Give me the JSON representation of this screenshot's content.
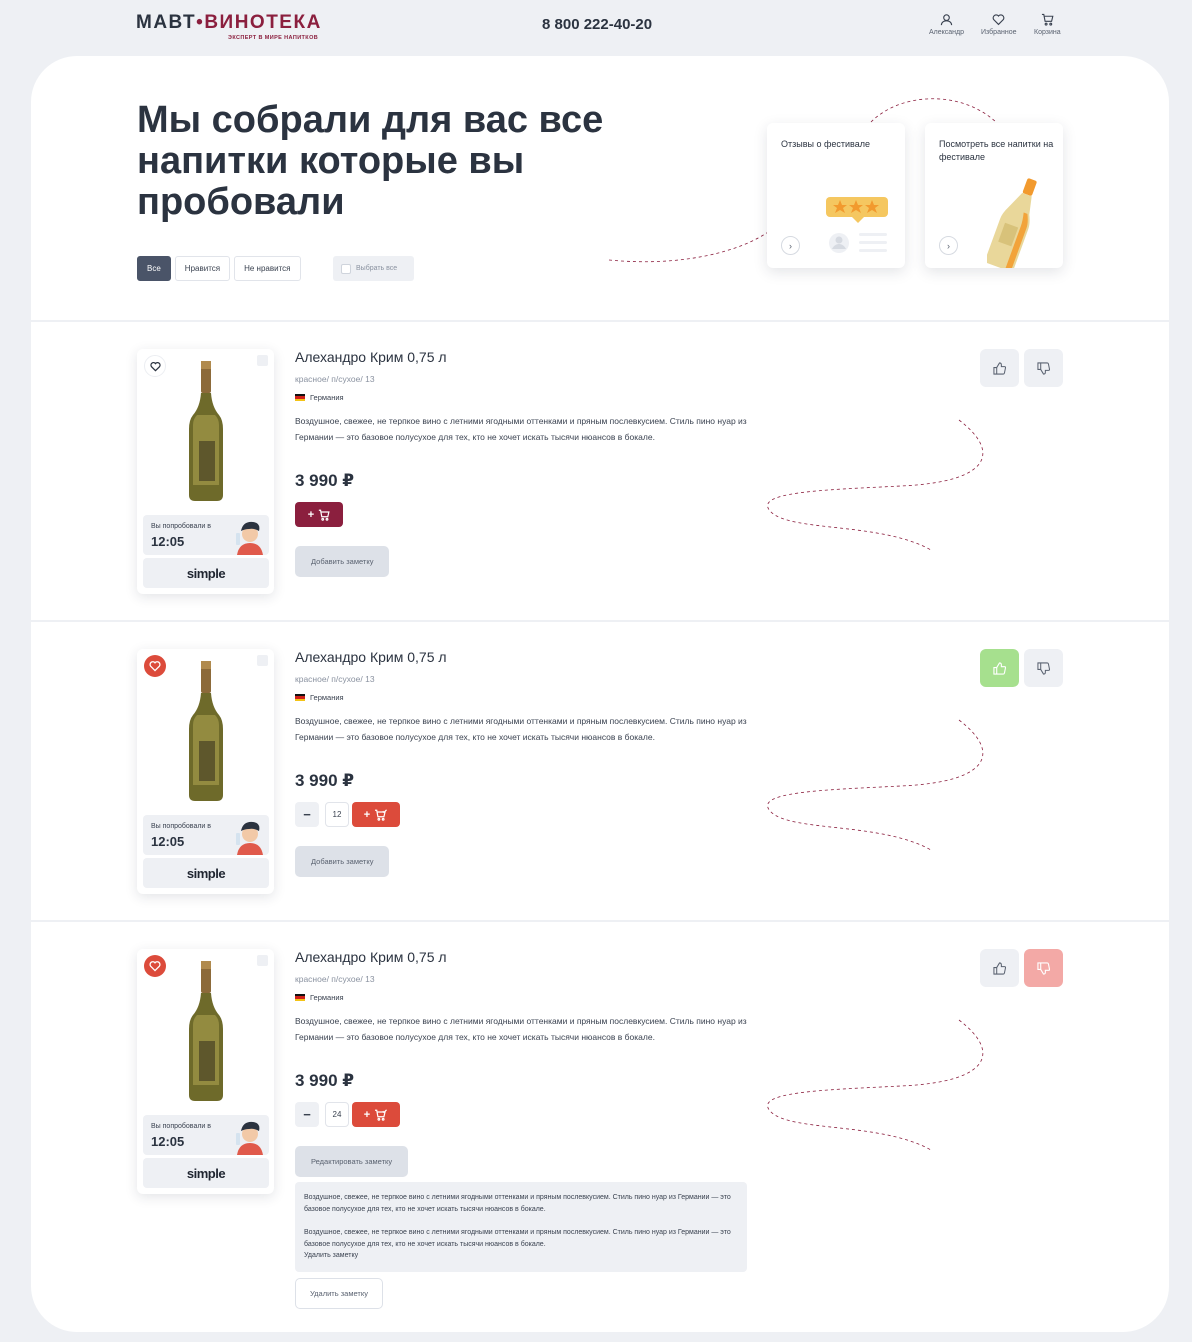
{
  "header": {
    "logo_left": "МАВТ",
    "logo_dot": "•",
    "logo_right": "ВИНОТЕКА",
    "logo_tagline": "ЭКСПЕРТ В МИРЕ НАПИТКОВ",
    "phone": "8 800 222-40-20",
    "nav": [
      {
        "label": "Александр",
        "icon": "user-icon"
      },
      {
        "label": "Избранное",
        "icon": "heart-icon"
      },
      {
        "label": "Корзина",
        "icon": "cart-icon"
      }
    ]
  },
  "hero": {
    "title": "Мы собрали для вас все напитки которые вы пробовали",
    "filters": [
      "Все",
      "Нравится",
      "Не нравится"
    ],
    "active_filter": "Все",
    "select_all": "Выбрать все",
    "promos": [
      {
        "title": "Отзывы о фестивале",
        "icon": "stars-review-illustration"
      },
      {
        "title": "Посмотреть все напитки на фестивале",
        "icon": "bottle-illustration"
      }
    ]
  },
  "products": [
    {
      "name": "Алехандро Крим 0,75 л",
      "meta": "красное/ п/сухое/ 13",
      "country": "Германия",
      "description": "Воздушное, свежее, не терпкое вино с летними ягодными оттенками и пряным послевкусием. Стиль пино нуар из Германии — это базовое полусухое для тех, кто не хочет искать тысячи нюансов в бокале.",
      "price": "3 990 ₽",
      "tried_label": "Вы попробовали в",
      "tried_time": "12:05",
      "brand": "simple",
      "favorite": false,
      "in_cart": false,
      "cart_label": "+",
      "vote": "none",
      "note_button": "Добавить заметку"
    },
    {
      "name": "Алехандро Крим 0,75 л",
      "meta": "красное/ п/сухое/ 13",
      "country": "Германия",
      "description": "Воздушное, свежее, не терпкое вино с летними ягодными оттенками и пряным послевкусием. Стиль пино нуар из Германии — это базовое полусухое для тех, кто не хочет искать тысячи нюансов в бокале.",
      "price": "3 990 ₽",
      "tried_label": "Вы попробовали в",
      "tried_time": "12:05",
      "brand": "simple",
      "favorite": true,
      "in_cart": true,
      "quantity": "12",
      "minus_label": "−",
      "cart_label": "+",
      "vote": "like",
      "note_button": "Добавить заметку"
    },
    {
      "name": "Алехандро Крим 0,75 л",
      "meta": "красное/ п/сухое/ 13",
      "country": "Германия",
      "description": "Воздушное, свежее, не терпкое вино с летними ягодными оттенками и пряным послевкусием. Стиль пино нуар из Германии — это базовое полусухое для тех, кто не хочет искать тысячи нюансов в бокале.",
      "price": "3 990 ₽",
      "tried_label": "Вы попробовали в",
      "tried_time": "12:05",
      "brand": "simple",
      "favorite": true,
      "in_cart": true,
      "quantity": "24",
      "minus_label": "−",
      "cart_label": "+",
      "vote": "dislike",
      "note_button": "Редактировать заметку",
      "note_paragraphs": [
        "Воздушное, свежее, не терпкое вино с летними ягодными оттенками и пряным послевкусием. Стиль пино нуар из Германии — это базовое полусухое для тех, кто не хочет искать тысячи нюансов в бокале.",
        "Воздушное, свежее, не терпкое вино с летними ягодными оттенками и пряным послевкусием. Стиль пино нуар из Германии — это базовое полусухое для тех, кто не хочет искать тысячи нюансов в бокале."
      ],
      "note_tail": "Удалить заметку",
      "delete_button": "Удалить заметку"
    }
  ],
  "colors": {
    "brand_maroon": "#8b1f3e",
    "accent_red": "#dc4b3b",
    "like_green": "#a6e08e",
    "dislike_pink": "#f3a9a6",
    "text_dark": "#2b3340",
    "bg_gray": "#eef0f4"
  }
}
